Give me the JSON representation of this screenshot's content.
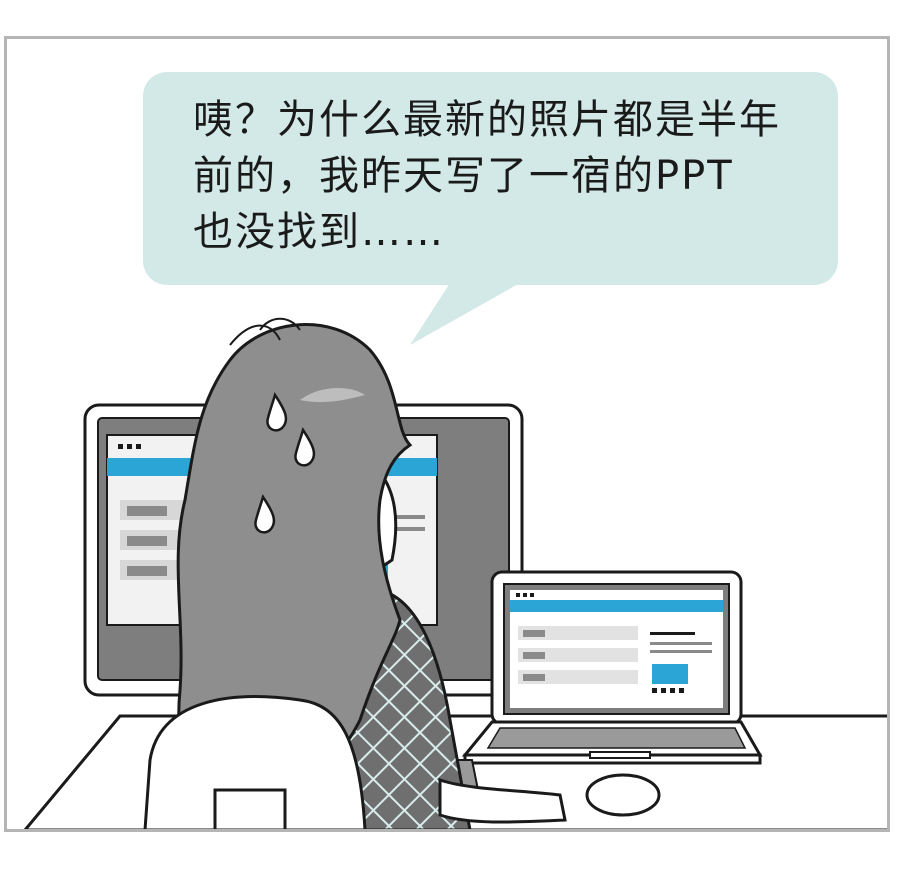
{
  "speech_bubble": {
    "lines": [
      "咦？为什么最新的照片都是半年",
      "前的，我昨天写了一宿的PPT",
      "也没找到……"
    ]
  },
  "colors": {
    "bubble": "#d2e9e8",
    "hair": "#8e8e8e",
    "accent_bar": "#2aa5d6",
    "panel_border": "#b5b5b5"
  }
}
